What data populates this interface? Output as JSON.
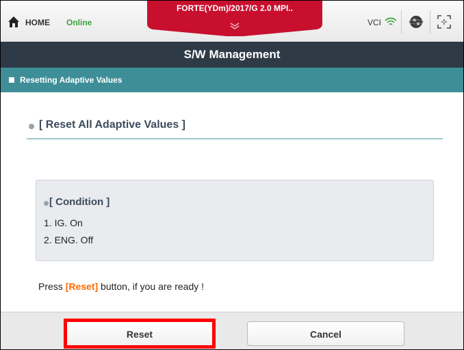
{
  "topbar": {
    "home_label": "HOME",
    "status": "Online",
    "vehicle": "FORTE(YDm)/2017/G 2.0 MPI..",
    "vci_label": "VCI",
    "colors": {
      "online": "#3aa33a",
      "vehicle_tab": "#c8102e"
    },
    "icons": [
      "home-icon",
      "chevron-down-icon",
      "wifi-icon",
      "globe-icon",
      "screen-capture-icon"
    ]
  },
  "title": "S/W Management",
  "section": {
    "title": "Resetting Adaptive Values",
    "color": "#3e8e97"
  },
  "content": {
    "heading": "[ Reset All Adaptive Values ]",
    "condition": {
      "title": "[ Condition ]",
      "items": [
        "1. IG. On",
        "2. ENG. Off"
      ]
    },
    "instruction": {
      "prefix": "Press ",
      "highlight": "[Reset]",
      "suffix": " button, if you are ready !",
      "highlight_color": "#ff6a00"
    }
  },
  "buttons": {
    "reset": "Reset",
    "cancel": "Cancel"
  }
}
